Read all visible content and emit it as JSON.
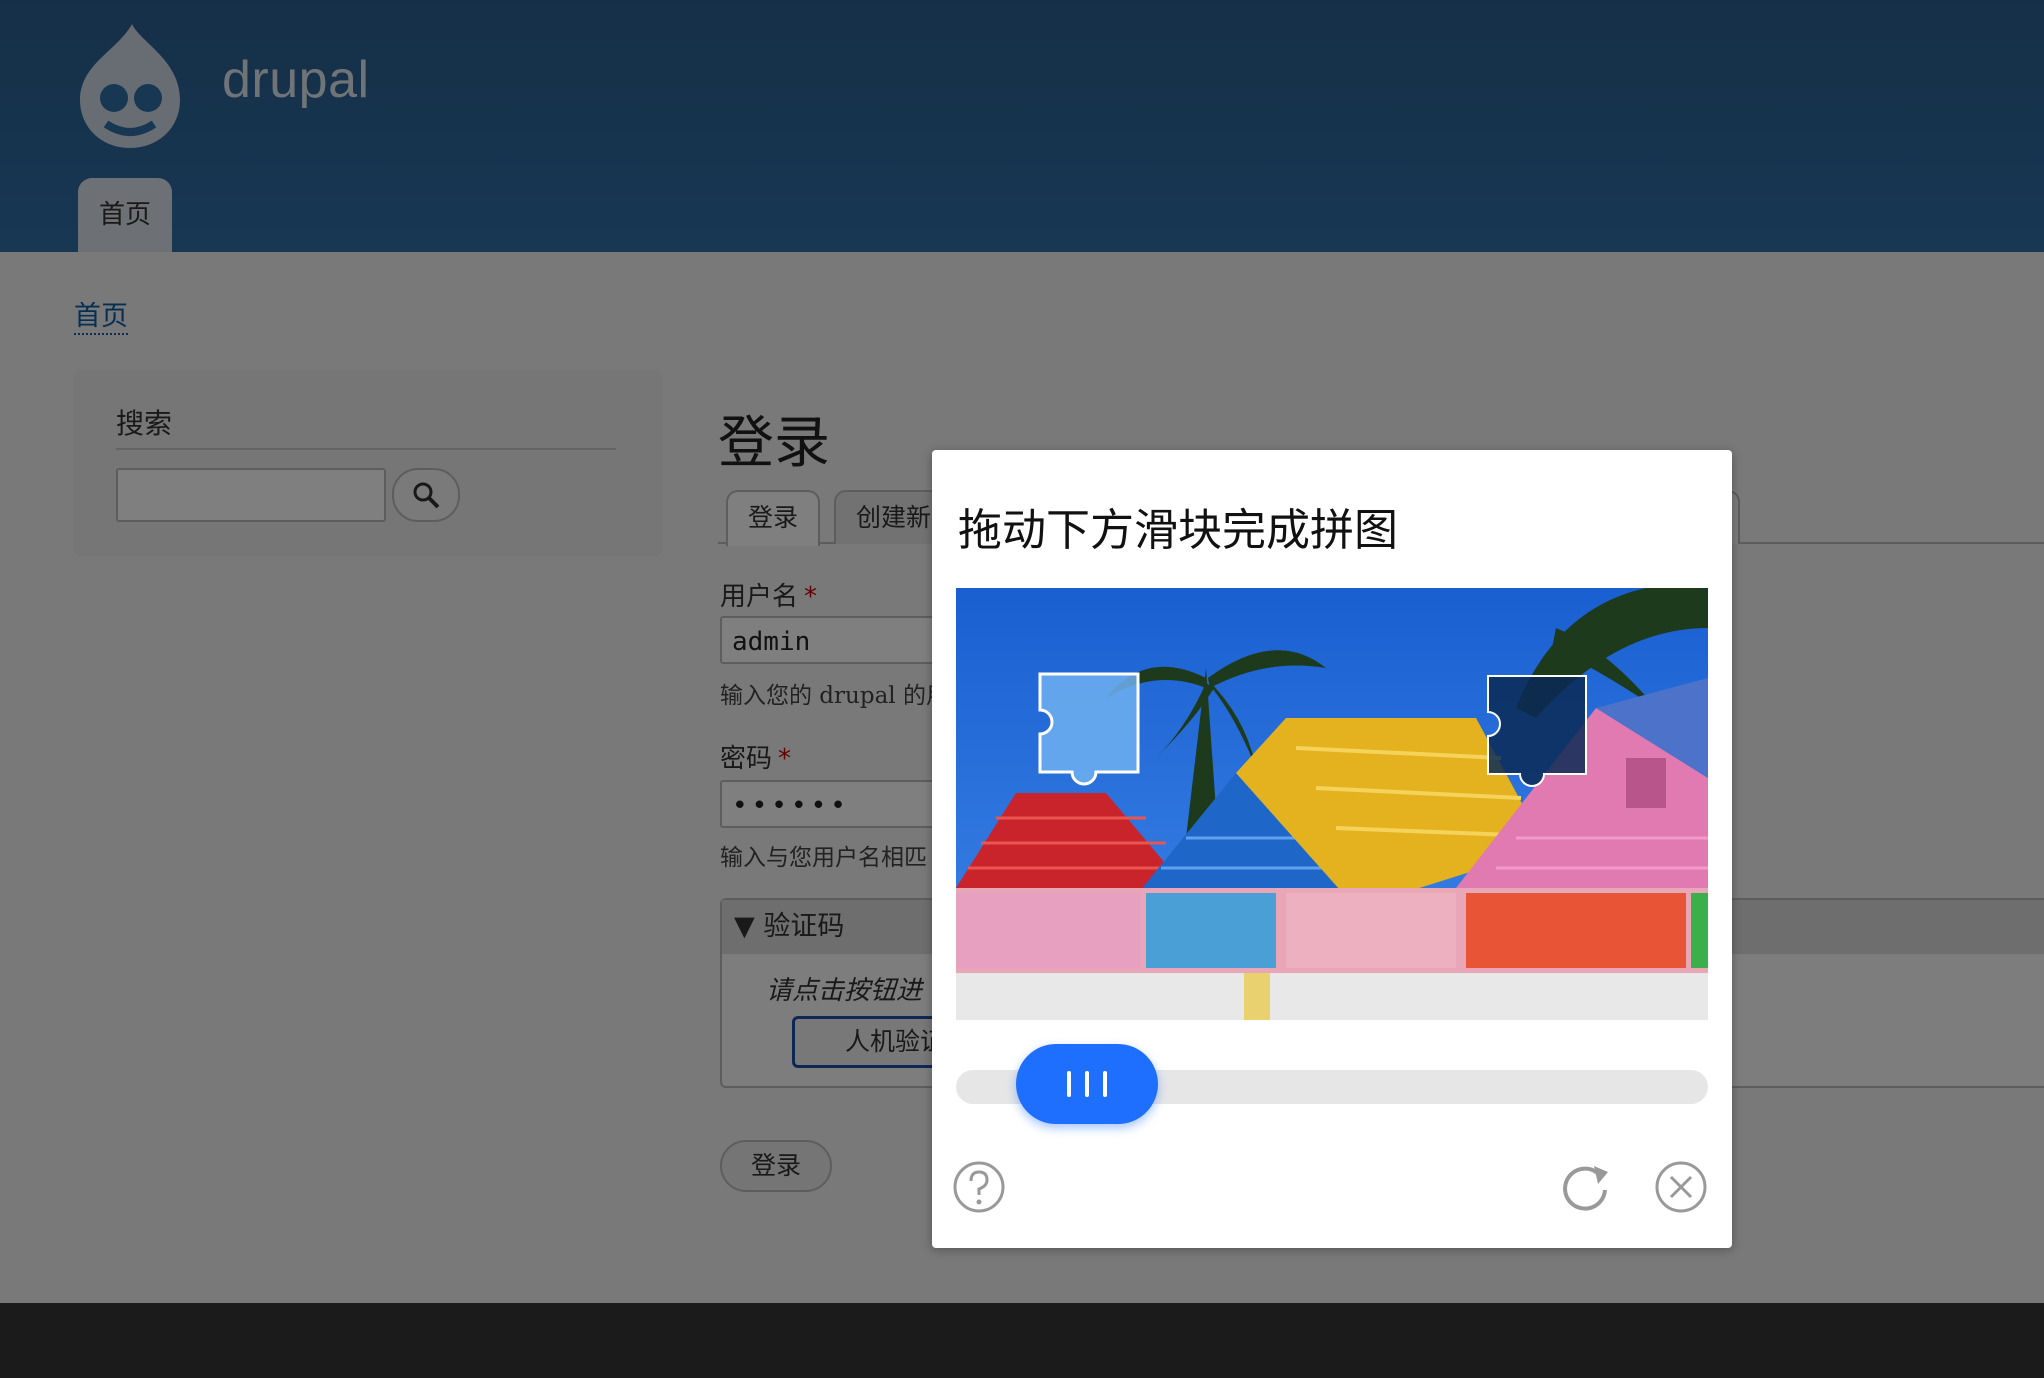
{
  "site": {
    "name": "drupal",
    "logo": "drupal-drop-logo"
  },
  "nav": {
    "home_tab": "首页"
  },
  "breadcrumb": {
    "home": "首页"
  },
  "search": {
    "title": "搜索",
    "placeholder": "",
    "button_icon": "search-icon"
  },
  "login": {
    "title": "登录",
    "tabs": [
      "登录",
      "创建新"
    ],
    "username": {
      "label": "用户名",
      "required": "*",
      "value": "admin",
      "description": "输入您的 drupal 的用"
    },
    "password": {
      "label": "密码",
      "required": "*",
      "value": "••••••",
      "description": "输入与您用户名相匹"
    },
    "captcha": {
      "legend": "▼ 验证码",
      "hint": "请点击按钮进",
      "verify_button": "人机验证"
    },
    "submit": "登录"
  },
  "modal": {
    "title": "拖动下方滑块完成拼图",
    "slider_position": 0.11,
    "icons": [
      "help-icon",
      "refresh-icon",
      "close-icon"
    ]
  },
  "colors": {
    "header": "#2f6fa7",
    "slider_accent": "#1f6fff",
    "required": "#cc0000"
  }
}
